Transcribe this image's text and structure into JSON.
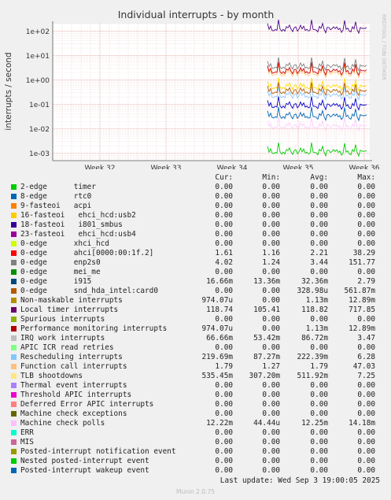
{
  "chart_data": {
    "type": "line",
    "title": "Individual interrupts - by month",
    "ylabel": "interrupts / second",
    "side_label": "RRDTOOL / TOBI OETIKER",
    "yscale": "log",
    "ylim": [
      0.0005,
      200
    ],
    "yticks": [
      "1e+02",
      "1e+01",
      "1e+00",
      "1e-01",
      "1e-02",
      "1e-03"
    ],
    "yticks_values": [
      100,
      10,
      1,
      0.1,
      0.01,
      0.001
    ],
    "xticks": [
      "Week 32",
      "Week 33",
      "Week 34",
      "Week 35",
      "Week 36"
    ],
    "grid": true,
    "series_drawn": [
      {
        "name": "rtc0",
        "level": 0.00113,
        "color": "#00cc00"
      },
      {
        "name": "i915",
        "level": 0.0323,
        "color": "#0066b3"
      },
      {
        "name": "Local timer interrupts",
        "level": 118.82,
        "color": "#4d0080"
      },
      {
        "name": "IRQ work interrupts",
        "level": 0.0867,
        "color": "#0000cc"
      },
      {
        "name": "Rescheduling interrupts",
        "level": 0.222,
        "color": "#8fc8ff"
      },
      {
        "name": "TLB shootdowns",
        "level": 0.512,
        "color": "#ffdd00"
      },
      {
        "name": "Function call interrupts",
        "level": 1.79,
        "color": "#ffc880"
      },
      {
        "name": "ahci[0000:00:1f.2]",
        "level": 2.21,
        "color": "#cc0000"
      },
      {
        "name": "enp2s0",
        "level": 3.44,
        "color": "#808080"
      },
      {
        "name": "Machine check polls",
        "level": 0.01225,
        "color": "#ffccff"
      },
      {
        "name": "snd_hda_intel:card0",
        "level": 0.329,
        "color": "#b35a00"
      }
    ]
  },
  "legend": {
    "headers": {
      "cur": "Cur:",
      "min": "Min:",
      "avg": "Avg:",
      "max": "Max:"
    },
    "rows": [
      {
        "name": "2-edge      timer",
        "color": "#00cc00",
        "cur": "0.00",
        "min": "0.00",
        "avg": "0.00",
        "max": "0.00"
      },
      {
        "name": "8-edge      rtc0",
        "color": "#0066b3",
        "cur": "0.00",
        "min": "0.00",
        "avg": "0.00",
        "max": "0.00"
      },
      {
        "name": "9-fasteoi   acpi",
        "color": "#ff8000",
        "cur": "0.00",
        "min": "0.00",
        "avg": "0.00",
        "max": "0.00"
      },
      {
        "name": "16-fasteoi   ehci_hcd:usb2",
        "color": "#ffcc00",
        "cur": "0.00",
        "min": "0.00",
        "avg": "0.00",
        "max": "0.00"
      },
      {
        "name": "18-fasteoi   i801_smbus",
        "color": "#330099",
        "cur": "0.00",
        "min": "0.00",
        "avg": "0.00",
        "max": "0.00"
      },
      {
        "name": "23-fasteoi   ehci_hcd:usb4",
        "color": "#990099",
        "cur": "0.00",
        "min": "0.00",
        "avg": "0.00",
        "max": "0.00"
      },
      {
        "name": "0-edge      xhci_hcd",
        "color": "#ccff00",
        "cur": "0.00",
        "min": "0.00",
        "avg": "0.00",
        "max": "0.00"
      },
      {
        "name": "0-edge      ahci[0000:00:1f.2]",
        "color": "#ff0000",
        "cur": "1.61",
        "min": "1.16",
        "avg": "2.21",
        "max": "38.29"
      },
      {
        "name": "0-edge      enp2s0",
        "color": "#808080",
        "cur": "4.02",
        "min": "1.24",
        "avg": "3.44",
        "max": "151.77"
      },
      {
        "name": "0-edge      mei_me",
        "color": "#008f00",
        "cur": "0.00",
        "min": "0.00",
        "avg": "0.00",
        "max": "0.00"
      },
      {
        "name": "0-edge      i915",
        "color": "#00487d",
        "cur": "16.66m",
        "min": "13.36m",
        "avg": "32.36m",
        "max": "2.79"
      },
      {
        "name": "0-edge      snd_hda_intel:card0",
        "color": "#b35a00",
        "cur": "0.00",
        "min": "0.00",
        "avg": "328.98u",
        "max": "561.87m"
      },
      {
        "name": "Non-maskable interrupts",
        "color": "#b38f00",
        "cur": "974.07u",
        "min": "0.00",
        "avg": "1.13m",
        "max": "12.89m"
      },
      {
        "name": "Local timer interrupts",
        "color": "#6b006b",
        "cur": "118.74",
        "min": "105.41",
        "avg": "118.82",
        "max": "717.85"
      },
      {
        "name": "Spurious interrupts",
        "color": "#8fb300",
        "cur": "0.00",
        "min": "0.00",
        "avg": "0.00",
        "max": "0.00"
      },
      {
        "name": "Performance monitoring interrupts",
        "color": "#b30000",
        "cur": "974.07u",
        "min": "0.00",
        "avg": "1.13m",
        "max": "12.89m"
      },
      {
        "name": "IRQ work interrupts",
        "color": "#bebebe",
        "cur": "66.66m",
        "min": "53.42m",
        "avg": "86.72m",
        "max": "3.47"
      },
      {
        "name": "APIC ICR read retries",
        "color": "#80ff80",
        "cur": "0.00",
        "min": "0.00",
        "avg": "0.00",
        "max": "0.00"
      },
      {
        "name": "Rescheduling interrupts",
        "color": "#80c9ff",
        "cur": "219.69m",
        "min": "87.27m",
        "avg": "222.39m",
        "max": "6.28"
      },
      {
        "name": "Function call interrupts",
        "color": "#ffc080",
        "cur": "1.79",
        "min": "1.27",
        "avg": "1.79",
        "max": "47.03"
      },
      {
        "name": "TLB shootdowns",
        "color": "#ffe680",
        "cur": "535.45m",
        "min": "307.20m",
        "avg": "511.92m",
        "max": "7.25"
      },
      {
        "name": "Thermal event interrupts",
        "color": "#aa80ff",
        "cur": "0.00",
        "min": "0.00",
        "avg": "0.00",
        "max": "0.00"
      },
      {
        "name": "Threshold APIC interrupts",
        "color": "#ee00cc",
        "cur": "0.00",
        "min": "0.00",
        "avg": "0.00",
        "max": "0.00"
      },
      {
        "name": "Deferred Error APIC interrupts",
        "color": "#ff8080",
        "cur": "0.00",
        "min": "0.00",
        "avg": "0.00",
        "max": "0.00"
      },
      {
        "name": "Machine check exceptions",
        "color": "#666600",
        "cur": "0.00",
        "min": "0.00",
        "avg": "0.00",
        "max": "0.00"
      },
      {
        "name": "Machine check polls",
        "color": "#ffbfff",
        "cur": "12.22m",
        "min": "44.44u",
        "avg": "12.25m",
        "max": "14.18m"
      },
      {
        "name": "ERR",
        "color": "#00ffcc",
        "cur": "0.00",
        "min": "0.00",
        "avg": "0.00",
        "max": "0.00"
      },
      {
        "name": "MIS",
        "color": "#cc6699",
        "cur": "0.00",
        "min": "0.00",
        "avg": "0.00",
        "max": "0.00"
      },
      {
        "name": "Posted-interrupt notification event",
        "color": "#999900",
        "cur": "0.00",
        "min": "0.00",
        "avg": "0.00",
        "max": "0.00"
      },
      {
        "name": "Nested posted-interrupt event",
        "color": "#00cc00",
        "cur": "0.00",
        "min": "0.00",
        "avg": "0.00",
        "max": "0.00"
      },
      {
        "name": "Posted-interrupt wakeup event",
        "color": "#0066b3",
        "cur": "0.00",
        "min": "0.00",
        "avg": "0.00",
        "max": "0.00"
      }
    ]
  },
  "footer": {
    "last_update": "Last update: Wed Sep  3 19:00:05 2025",
    "munin": "Munin 2.0.75"
  }
}
